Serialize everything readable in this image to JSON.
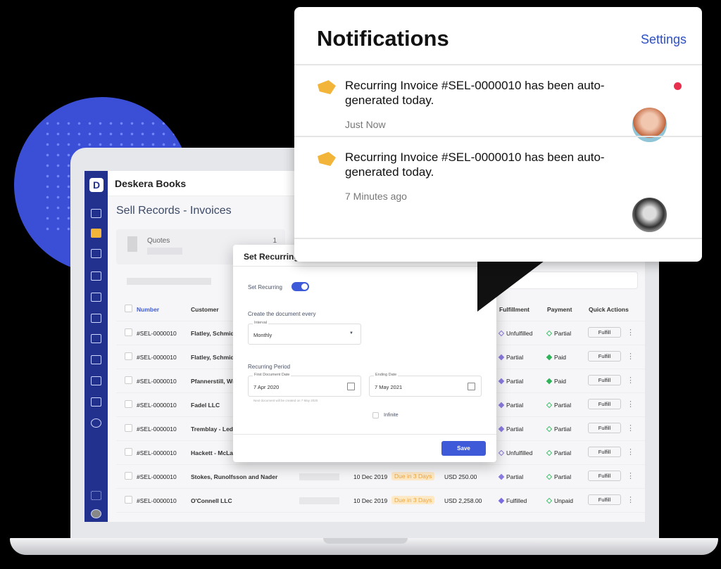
{
  "app": {
    "logo_letter": "D",
    "title": "Deskera Books",
    "page_title": "Sell Records - Invoices"
  },
  "summary": {
    "label": "Quotes",
    "count": "1"
  },
  "table": {
    "headers": [
      "Number",
      "Customer",
      "Fulfillment",
      "Payment",
      "Quick Actions"
    ],
    "rows": [
      {
        "number": "#SEL-0000010",
        "customer": "Flatley, Schmid",
        "date": "",
        "due": "",
        "amount": "",
        "fulfillment": "Unfulfilled",
        "payment": "Partial",
        "action": "Fulfill"
      },
      {
        "number": "#SEL-0000010",
        "customer": "Flatley, Schmid",
        "date": "",
        "due": "",
        "amount": "",
        "fulfillment": "Partial",
        "payment": "Paid",
        "action": "Fulfill"
      },
      {
        "number": "#SEL-0000010",
        "customer": "Pfannerstill, Wi",
        "date": "",
        "due": "",
        "amount": "",
        "fulfillment": "Partial",
        "payment": "Paid",
        "action": "Fulfill"
      },
      {
        "number": "#SEL-0000010",
        "customer": "Fadel LLC",
        "date": "",
        "due": "",
        "amount": "",
        "fulfillment": "Partial",
        "payment": "Partial",
        "action": "Fulfill"
      },
      {
        "number": "#SEL-0000010",
        "customer": "Tremblay - Led",
        "date": "",
        "due": "",
        "amount": "",
        "fulfillment": "Partial",
        "payment": "Partial",
        "action": "Fulfill"
      },
      {
        "number": "#SEL-0000010",
        "customer": "Hackett - McLa",
        "date": "",
        "due": "",
        "amount": "",
        "fulfillment": "Unfulfilled",
        "payment": "Partial",
        "action": "Fulfill"
      },
      {
        "number": "#SEL-0000010",
        "customer": "Stokes, Runolfsson and Nader",
        "date": "10 Dec 2019",
        "due": "Due in 3 Days",
        "amount": "USD 250.00",
        "fulfillment": "Partial",
        "payment": "Partial",
        "action": "Fulfill"
      },
      {
        "number": "#SEL-0000010",
        "customer": "O'Connell LLC",
        "date": "10 Dec 2019",
        "due": "Due in 3 Days",
        "amount": "USD 2,258.00",
        "fulfillment": "Fulfilled",
        "payment": "Unpaid",
        "action": "Fulfill"
      }
    ]
  },
  "modal": {
    "title": "Set Recurring",
    "toggle_label": "Set Recurring",
    "toggle_on": true,
    "every_label": "Create the document every",
    "interval_label": "Interval",
    "interval_value": "Monthly",
    "period_label": "Recurring Period",
    "first_date_label": "First Document Date",
    "first_date": "7 Apr 2020",
    "end_date_label": "Ending Date",
    "end_date": "7 May 2021",
    "hint": "Next document will be created on 7 May 2020",
    "infinite_label": "Infinite",
    "save": "Save"
  },
  "notifications": {
    "title": "Notifications",
    "settings": "Settings",
    "items": [
      {
        "message": "Recurring Invoice #SEL-0000010 has been auto-generated today.",
        "time": "Just Now",
        "unread": true
      },
      {
        "message": "Recurring Invoice #SEL-0000010 has been auto-generated today.",
        "time": "7 Minutes ago",
        "unread": false
      }
    ]
  },
  "colors": {
    "accent": "#3e5ad8",
    "sidebar": "#23318e",
    "unread": "#e8304e",
    "tag": "#f2b53a",
    "circle": "#3a4fd6"
  }
}
